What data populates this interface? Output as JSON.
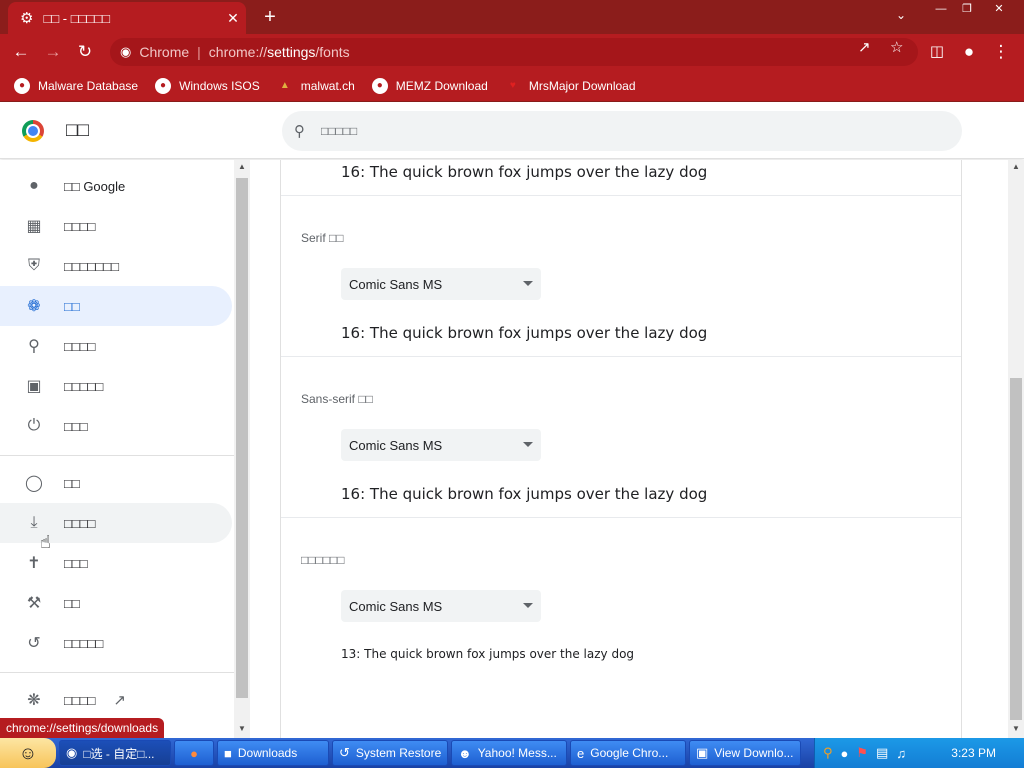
{
  "browser": {
    "tab_title": "□□ - □□□□□",
    "tab_close": "✕",
    "new_tab": "+",
    "omnibox_prefix": "Chrome",
    "url_scheme": "chrome://",
    "url_host": "settings",
    "url_path": "/fonts"
  },
  "bookmarks": [
    {
      "label": "Malware Database",
      "icon": "globe-icon"
    },
    {
      "label": "Windows ISOS",
      "icon": "globe-icon"
    },
    {
      "label": "malwat.ch",
      "icon": "flask-icon"
    },
    {
      "label": "MEMZ Download",
      "icon": "globe-icon"
    },
    {
      "label": "MrsMajor Download",
      "icon": "heart-icon"
    }
  ],
  "header": {
    "title": "□□",
    "search_placeholder": "□□□□□"
  },
  "sidebar": {
    "items": [
      {
        "label": "□□ Google",
        "icon": "person-icon"
      },
      {
        "label": "□□□□",
        "icon": "clipboard-icon"
      },
      {
        "label": "□□□□□□□",
        "icon": "shield-icon"
      },
      {
        "label": "□□",
        "icon": "palette-icon",
        "active": true
      },
      {
        "label": "□□□□",
        "icon": "search-icon"
      },
      {
        "label": "□□□□□",
        "icon": "browser-icon"
      },
      {
        "label": "□□□",
        "icon": "power-icon"
      },
      {
        "label": "□□",
        "icon": "globe-icon"
      },
      {
        "label": "□□□□",
        "icon": "download-icon",
        "hover": true
      },
      {
        "label": "□□□",
        "icon": "accessibility-icon"
      },
      {
        "label": "□□",
        "icon": "wrench-icon"
      },
      {
        "label": "□□□□□",
        "icon": "history-icon"
      },
      {
        "label": "□□□□",
        "icon": "extension-icon"
      }
    ]
  },
  "fonts": {
    "standard_sample": "16: The quick brown fox jumps over the lazy dog",
    "serif": {
      "label": "Serif □□",
      "value": "Comic Sans MS",
      "sample": "16: The quick brown fox jumps over the lazy dog"
    },
    "sans_serif": {
      "label": "Sans-serif □□",
      "value": "Comic Sans MS",
      "sample": "16: The quick brown fox jumps over the lazy dog"
    },
    "fixed_width": {
      "label": "□□□□□□",
      "value": "Comic Sans MS",
      "sample": "13: The quick brown fox jumps over the lazy dog"
    }
  },
  "status_tooltip": "chrome://settings/downloads",
  "taskbar": {
    "items": [
      {
        "label": "□选 - 自定□...",
        "icon": "chrome-icon"
      },
      {
        "label": "",
        "icon": "firefox-icon"
      },
      {
        "label": "Downloads",
        "icon": "folder-icon"
      },
      {
        "label": "System Restore",
        "icon": "restore-icon"
      },
      {
        "label": "Yahoo! Mess...",
        "icon": "yahoo-icon"
      },
      {
        "label": "Google Chro...",
        "icon": "ie-icon"
      },
      {
        "label": "View Downlo...",
        "icon": "window-icon"
      }
    ],
    "clock": "3:23 PM"
  },
  "colors": {
    "chrome_frame": "#b51c20",
    "title_bar": "#8b1d1b",
    "active_nav": "#e8f0fe",
    "taskbar": "#245edb"
  }
}
